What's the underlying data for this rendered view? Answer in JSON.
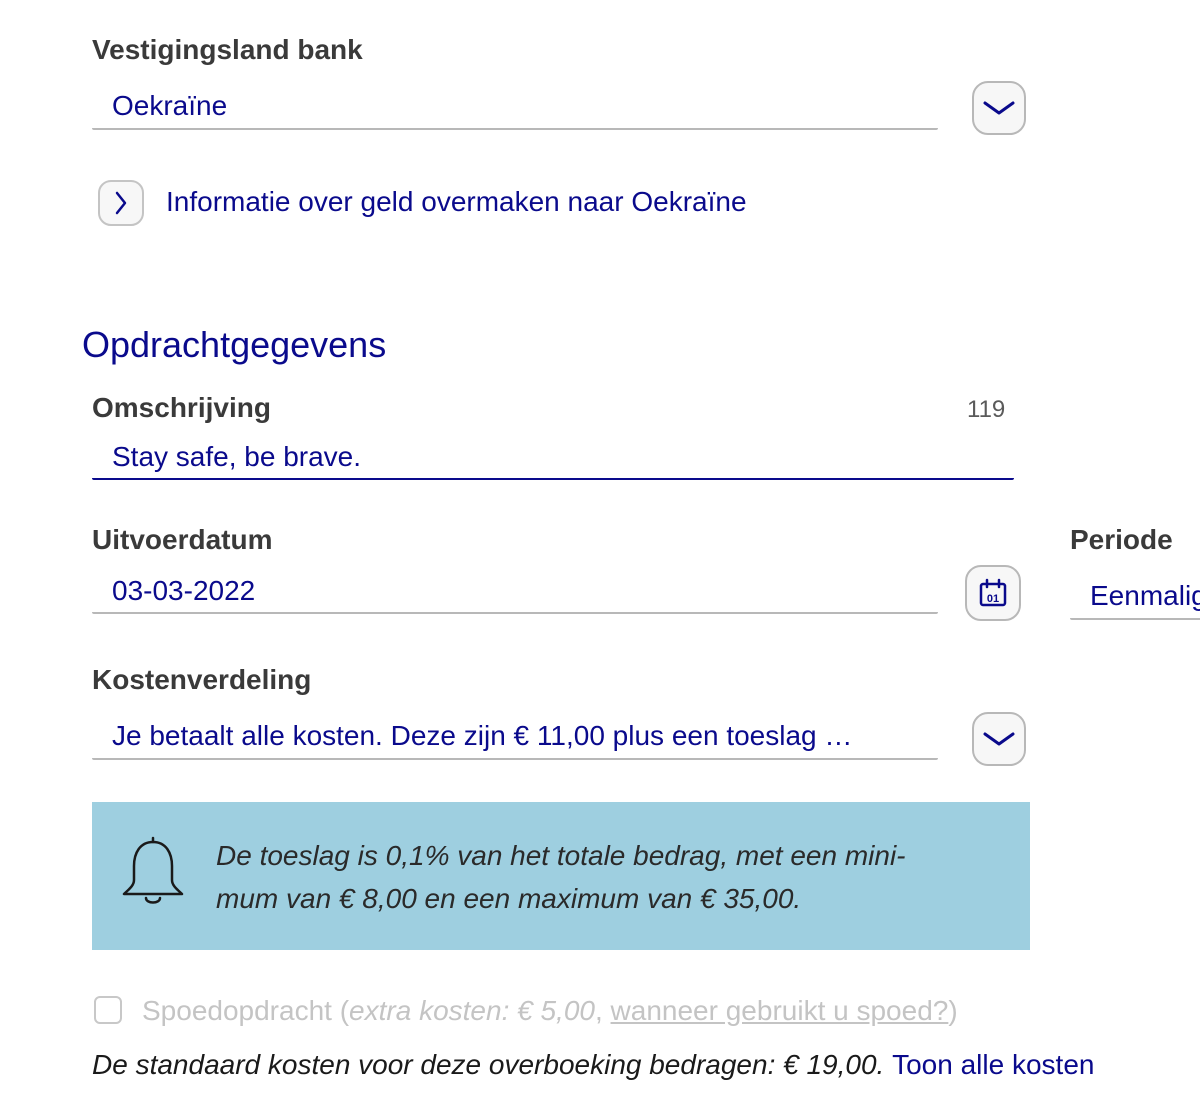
{
  "bank_country": {
    "label": "Vestigingsland bank",
    "value": "Oekraïne",
    "info_link": "Informatie over geld overmaken naar Oekraïne"
  },
  "order_details": {
    "title": "Opdrachtgegevens",
    "description": {
      "label": "Omschrijving",
      "counter": "119",
      "value": "Stay safe, be brave."
    },
    "execution_date": {
      "label": "Uitvoerdatum",
      "value": "03-03-2022",
      "calendar_day": "01"
    },
    "period": {
      "label": "Periode",
      "value": "Eenmalig"
    },
    "cost_split": {
      "label": "Kostenverdeling",
      "value": "Je betaalt alle kosten. Deze zijn € 11,00 plus een toeslag …"
    },
    "notice": {
      "line1": "De toeslag is 0,1% van het totale bedrag, met een mini-",
      "line2": "mum van € 8,00 en een maximum van € 35,00."
    },
    "express": {
      "label": "Spoedopdracht",
      "open_paren": " (",
      "extra_costs": "extra kosten: € 5,00",
      "comma": ", ",
      "when_link": "wanneer gebruikt u spoed?",
      "close_paren": ")"
    },
    "standard_costs": {
      "text": "De standaard kosten voor deze overboeking bedragen: € 19,00.",
      "link": "Toon alle kosten"
    }
  },
  "colors": {
    "accent": "#0a0a8c",
    "notice_bg": "#9ecfe0",
    "label": "#3a3a3a",
    "muted": "#c4c4c4"
  }
}
